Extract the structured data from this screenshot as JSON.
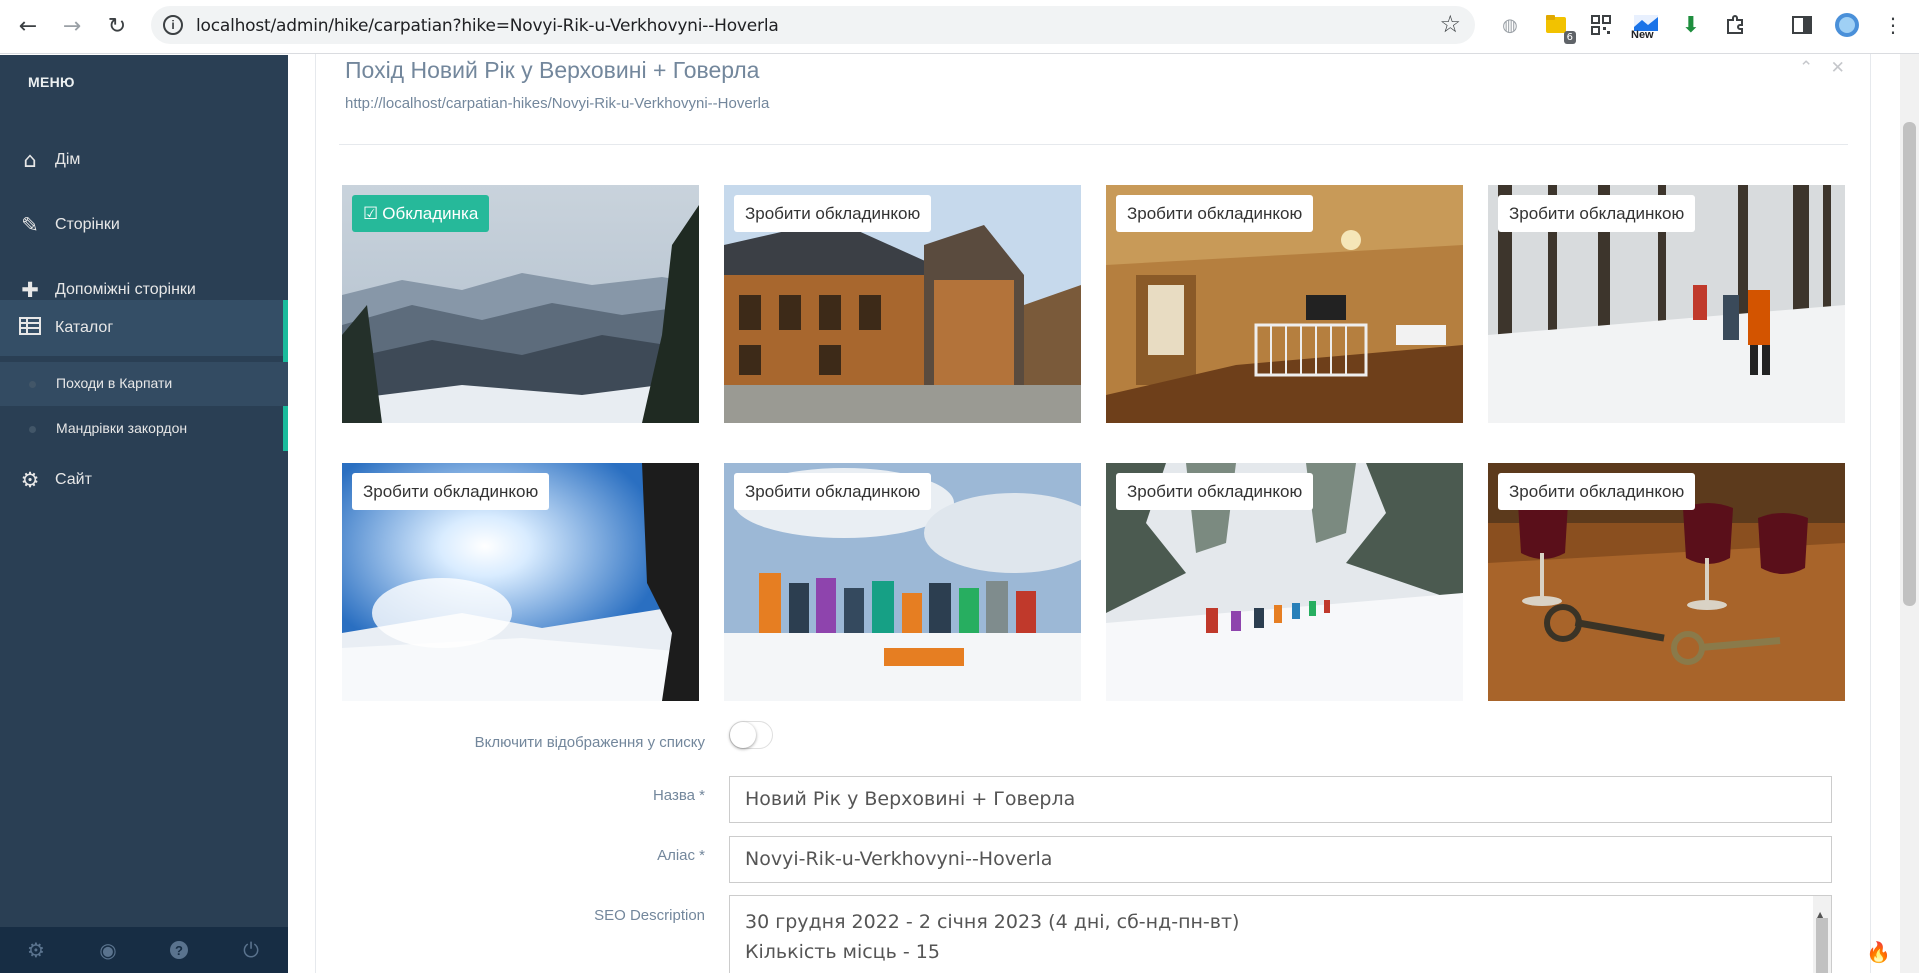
{
  "browser": {
    "url": "localhost/admin/hike/carpatian?hike=Novyi-Rik-u-Verkhovyni--Hoverla",
    "extension_badge": "6",
    "extension_new_label": "New"
  },
  "sidebar": {
    "menu_title": "МЕНЮ",
    "items": [
      {
        "label": "Дім",
        "icon": "home-icon"
      },
      {
        "label": "Сторінки",
        "icon": "edit-icon"
      },
      {
        "label": "Допоміжні сторінки",
        "icon": "plus-icon"
      },
      {
        "label": "Каталог",
        "icon": "table-icon"
      },
      {
        "label": "Сайт",
        "icon": "gear-icon"
      }
    ],
    "subitems": [
      {
        "label": "Походи в Карпати"
      },
      {
        "label": "Мандрівки закордон"
      }
    ],
    "footer_icons": [
      "settings-icon",
      "eye-icon",
      "help-icon",
      "power-icon"
    ]
  },
  "panel": {
    "title": "Похід Новий Рік у Верховині + Говерла",
    "url": "http://localhost/carpatian-hikes/Novyi-Rik-u-Verkhovyni--Hoverla"
  },
  "gallery": {
    "cover_label": "Обкладинка",
    "make_cover_label": "Зробити обкладинкою",
    "photos": [
      {
        "scene": "mountain-panorama",
        "is_cover": true
      },
      {
        "scene": "wooden-house",
        "is_cover": false
      },
      {
        "scene": "wooden-interior",
        "is_cover": false
      },
      {
        "scene": "snowy-forest-hikers",
        "is_cover": false
      },
      {
        "scene": "snow-sun-spray",
        "is_cover": false
      },
      {
        "scene": "group-photo-snow",
        "is_cover": false
      },
      {
        "scene": "snowy-trail-line",
        "is_cover": false
      },
      {
        "scene": "wine-glasses-keys",
        "is_cover": false
      }
    ]
  },
  "form": {
    "show_in_list_label": "Включити відображення у списку",
    "show_in_list_value": false,
    "name_label": "Назва *",
    "name_value": "Новий Рік у Верховині + Говерла",
    "alias_label": "Аліас *",
    "alias_value": "Novyi-Rik-u-Verkhovyni--Hoverla",
    "seo_label": "SEO Description",
    "seo_line1": "30 грудня 2022 - 2 січня 2023 (4 дні, сб-нд-пн-вт)",
    "seo_line2": "Кількість місць - 15"
  },
  "colors": {
    "sidebar_bg": "#2a3f54",
    "accent": "#1abb9c",
    "cover_button": "#26b99a"
  }
}
